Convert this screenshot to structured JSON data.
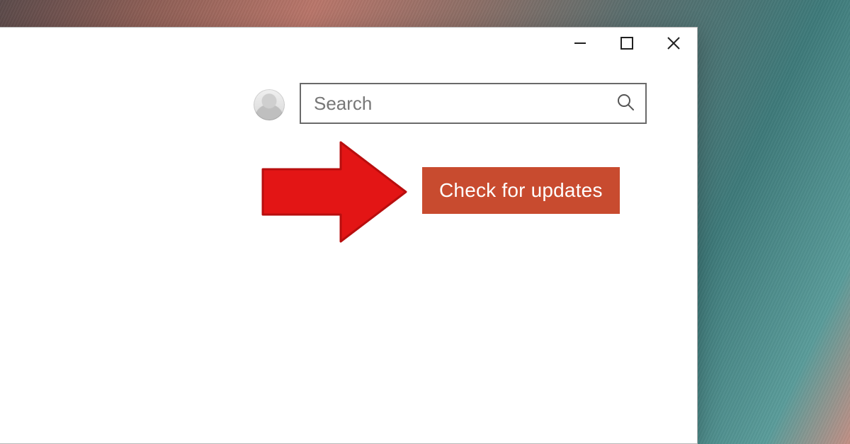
{
  "search": {
    "placeholder": "Search",
    "value": ""
  },
  "buttons": {
    "check_updates": "Check for updates"
  },
  "colors": {
    "accent": "#c84b2f",
    "annotation_arrow": "#e31515"
  },
  "icons": {
    "minimize": "minimize-icon",
    "maximize": "maximize-icon",
    "close": "close-icon",
    "search": "search-icon",
    "avatar": "avatar-icon",
    "annotation_arrow": "annotation-arrow-icon"
  }
}
